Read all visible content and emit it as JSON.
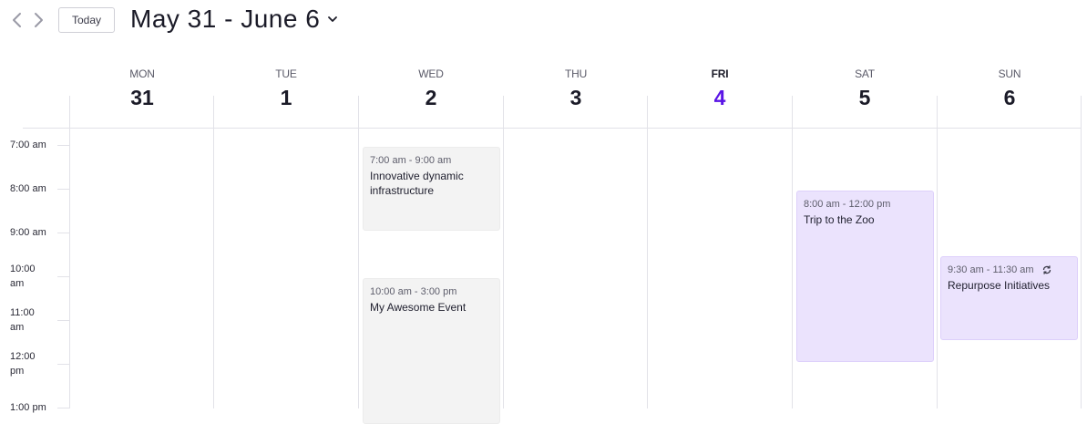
{
  "toolbar": {
    "today_label": "Today",
    "range_title": "May 31 - June 6"
  },
  "days": [
    {
      "dow": "MON",
      "num": "31"
    },
    {
      "dow": "TUE",
      "num": "1"
    },
    {
      "dow": "WED",
      "num": "2"
    },
    {
      "dow": "THU",
      "num": "3"
    },
    {
      "dow": "FRI",
      "num": "4",
      "today": true
    },
    {
      "dow": "SAT",
      "num": "5"
    },
    {
      "dow": "SUN",
      "num": "6"
    }
  ],
  "hours": [
    "7:00 am",
    "8:00 am",
    "9:00 am",
    "10:00 am",
    "11:00 am",
    "12:00 pm",
    "1:00 pm"
  ],
  "events": [
    {
      "time": "7:00 am - 9:00 am",
      "title": "Innovative dynamic infrastructure"
    },
    {
      "time": "10:00 am - 3:00 pm",
      "title": "My Awesome Event"
    },
    {
      "time": "8:00 am - 12:00 pm",
      "title": "Trip to the Zoo"
    },
    {
      "time": "9:30 am - 11:30 am",
      "title": "Repurpose Initiatives",
      "recurring_icon": "repeat-icon"
    }
  ],
  "colors": {
    "today_accent": "#5a14e6",
    "event_grey": "#f3f3f3",
    "event_purple": "#ebe3fd"
  }
}
